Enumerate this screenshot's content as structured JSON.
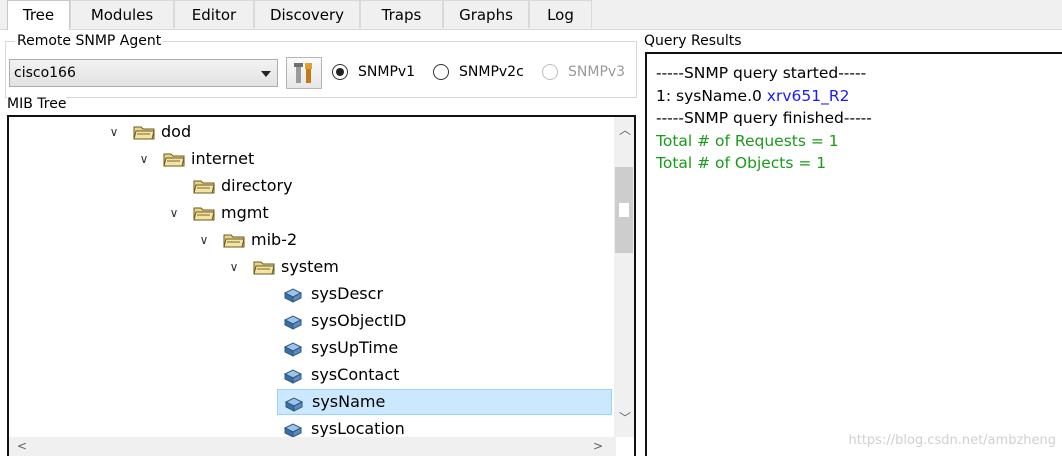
{
  "tabs": [
    "Tree",
    "Modules",
    "Editor",
    "Discovery",
    "Traps",
    "Graphs",
    "Log"
  ],
  "agent": {
    "group_label": "Remote SNMP Agent",
    "selected": "cisco166",
    "tool_icon": "wrench-screwdriver-icon",
    "versions": [
      "SNMPv1",
      "SNMPv2c",
      "SNMPv3"
    ],
    "selected_version": "SNMPv1",
    "disabled_version": "SNMPv3"
  },
  "mib": {
    "label": "MIB Tree",
    "nodes": [
      {
        "label": "dod",
        "type": "folder",
        "expanded": true,
        "depth": 0
      },
      {
        "label": "internet",
        "type": "folder",
        "expanded": true,
        "depth": 1
      },
      {
        "label": "directory",
        "type": "folder",
        "expanded": false,
        "depth": 2
      },
      {
        "label": "mgmt",
        "type": "folder",
        "expanded": true,
        "depth": 2
      },
      {
        "label": "mib-2",
        "type": "folder",
        "expanded": true,
        "depth": 3
      },
      {
        "label": "system",
        "type": "folder",
        "expanded": true,
        "depth": 4
      },
      {
        "label": "sysDescr",
        "type": "leaf",
        "depth": 5
      },
      {
        "label": "sysObjectID",
        "type": "leaf",
        "depth": 5
      },
      {
        "label": "sysUpTime",
        "type": "leaf",
        "depth": 5
      },
      {
        "label": "sysContact",
        "type": "leaf",
        "depth": 5
      },
      {
        "label": "sysName",
        "type": "leaf",
        "depth": 5,
        "selected": true
      },
      {
        "label": "sysLocation",
        "type": "leaf",
        "depth": 5
      }
    ]
  },
  "results": {
    "label": "Query Results",
    "started": "-----SNMP query started-----",
    "result_prefix": "1: sysName.0",
    "result_value": "xrv651_R2",
    "finished": "-----SNMP query finished-----",
    "total_requests": "Total # of Requests = 1",
    "total_objects": "Total # of Objects = 1"
  },
  "colors": {
    "value_blue": "#1a1aff",
    "total_green": "#1a9a1a",
    "selection": "#cce8ff"
  },
  "watermark": "https://blog.csdn.net/ambzheng"
}
